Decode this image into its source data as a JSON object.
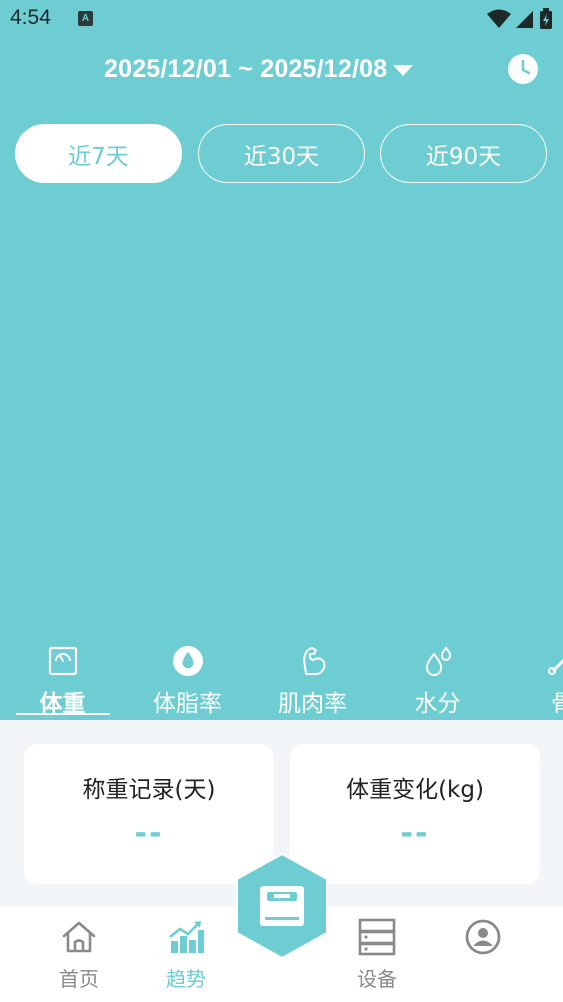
{
  "status_bar": {
    "time": "4:54",
    "notification_letter": "A"
  },
  "header": {
    "date_range": "2025/12/01 ~ 2025/12/08",
    "dropdown_icon": "caret-down-icon",
    "history_icon": "clock-icon"
  },
  "range_buttons": [
    {
      "label": "近7天",
      "active": true
    },
    {
      "label": "近30天",
      "active": false
    },
    {
      "label": "近90天",
      "active": false
    }
  ],
  "metric_tabs": [
    {
      "label": "体重",
      "icon": "scale-icon",
      "active": true
    },
    {
      "label": "体脂率",
      "icon": "drop-icon",
      "active": false
    },
    {
      "label": "肌肉率",
      "icon": "muscle-icon",
      "active": false
    },
    {
      "label": "水分",
      "icon": "water-icon",
      "active": false
    },
    {
      "label": "骨",
      "icon": "bone-icon",
      "active": false
    }
  ],
  "cards": [
    {
      "title": "称重记录(天)",
      "value": "--"
    },
    {
      "title": "体重变化(kg)",
      "value": "--"
    }
  ],
  "bottom_nav": [
    {
      "label": "首页",
      "icon": "home-icon",
      "active": false
    },
    {
      "label": "趋势",
      "icon": "chart-icon",
      "active": true
    },
    {
      "label": "设备",
      "icon": "device-icon",
      "active": false
    },
    {
      "label": "",
      "icon": "profile-icon",
      "active": false
    }
  ],
  "center_button": {
    "icon": "scale-icon"
  },
  "colors": {
    "accent": "#6dcdd2",
    "background": "#f3f6f9",
    "card": "#ffffff"
  }
}
